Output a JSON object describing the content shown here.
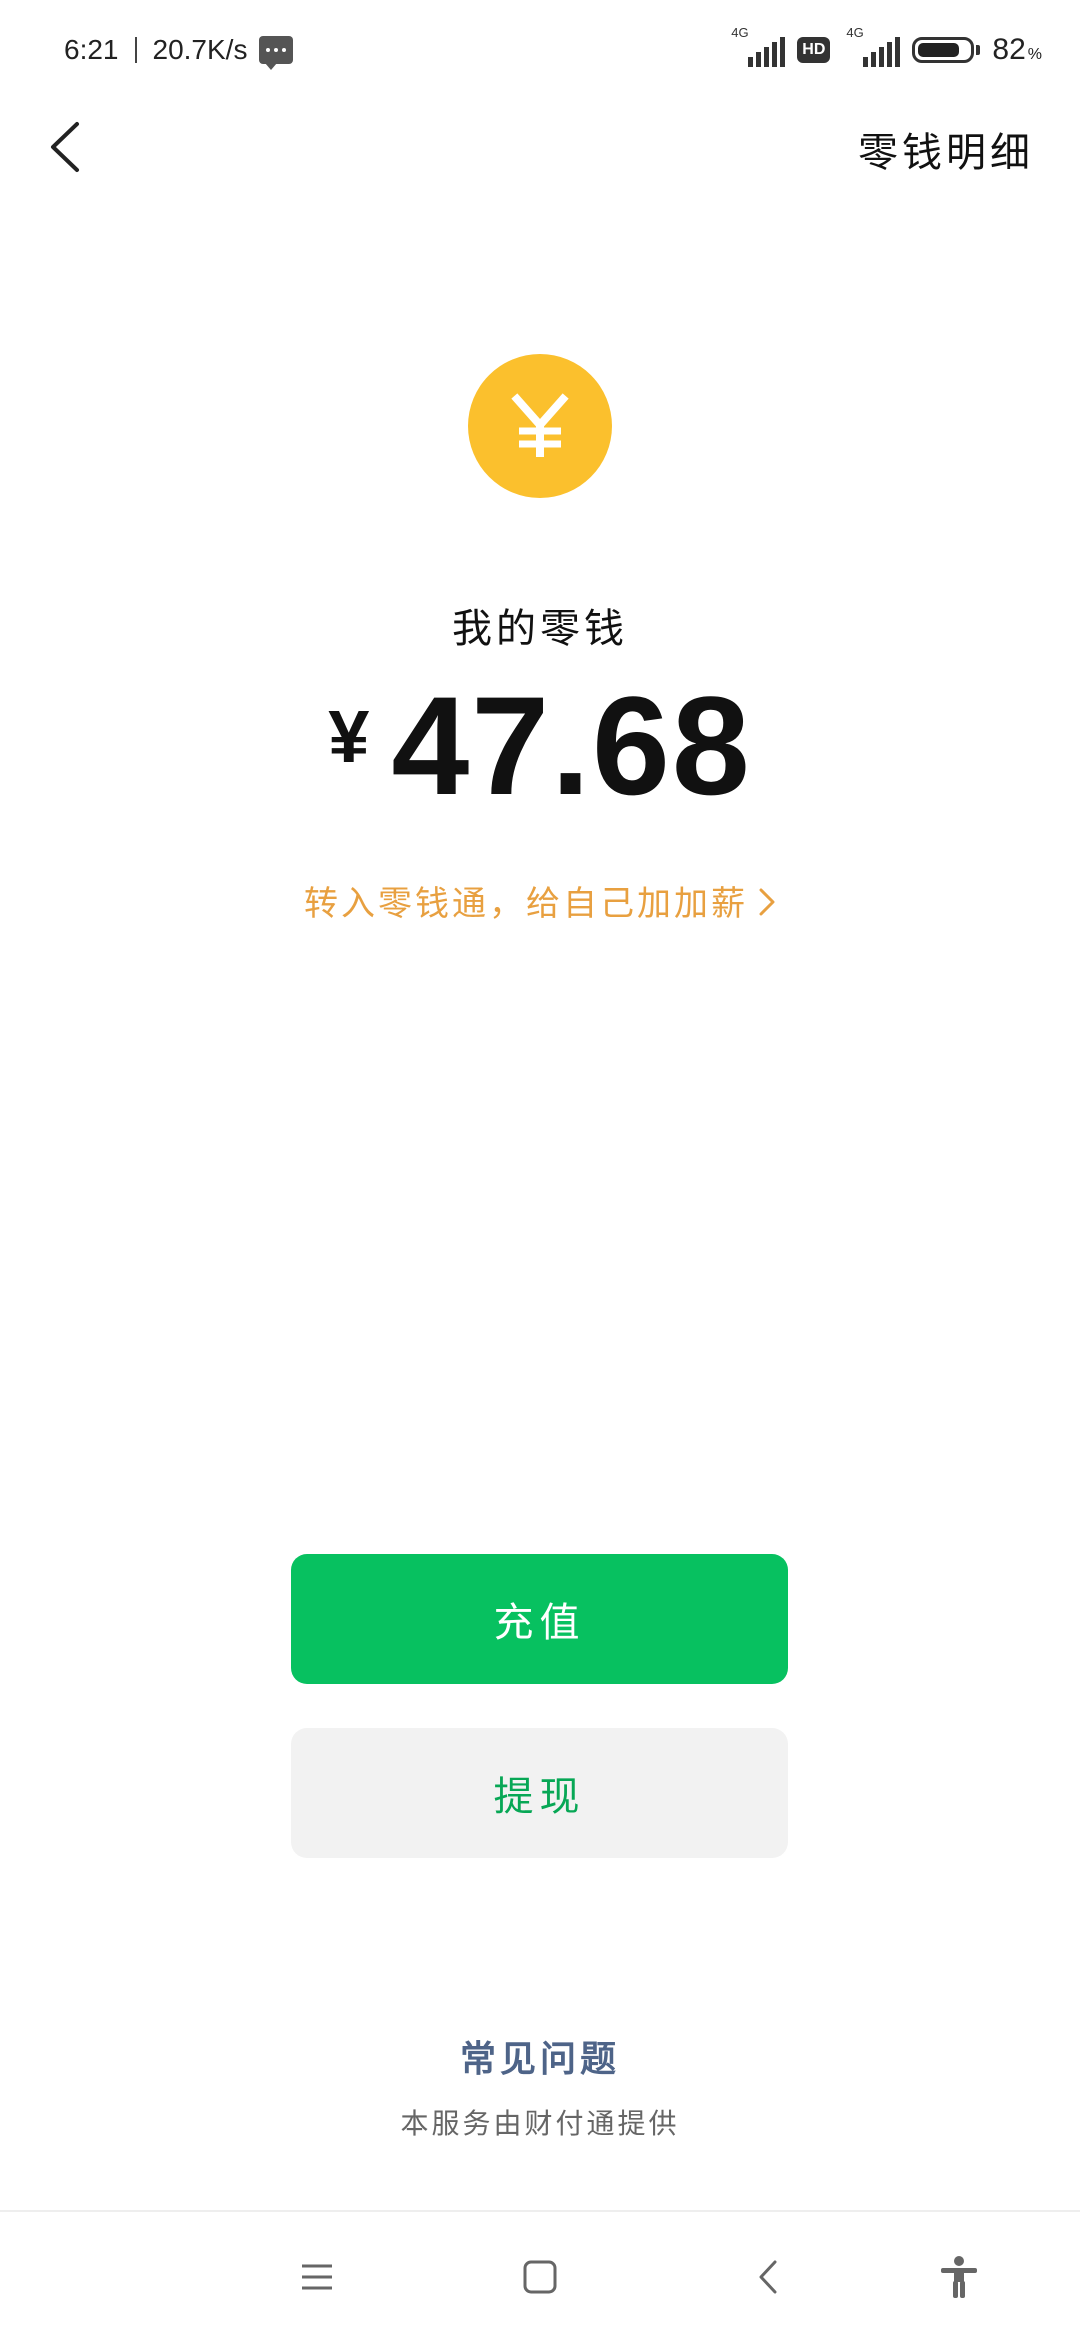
{
  "status_bar": {
    "time": "6:21",
    "net_speed": "20.7K/s",
    "signal_1_label": "4G",
    "hd_label": "HD",
    "signal_2_label": "4G",
    "battery_level": 82,
    "battery_text": "82",
    "battery_unit": "%"
  },
  "header": {
    "detail_link": "零钱明细"
  },
  "wallet": {
    "label": "我的零钱",
    "currency_symbol": "¥",
    "balance": "47.68",
    "promo_text": "转入零钱通，给自己加加薪"
  },
  "buttons": {
    "recharge": "充值",
    "withdraw": "提现"
  },
  "footer": {
    "faq": "常见问题",
    "provider": "本服务由财付通提供"
  },
  "icons": {
    "coin": "yuan-coin-icon",
    "back": "back-arrow-icon"
  },
  "colors": {
    "brand_green": "#07C160",
    "coin_yellow": "#FBC02D",
    "promo_orange": "#E8A040",
    "faq_blue": "#4E6488"
  }
}
